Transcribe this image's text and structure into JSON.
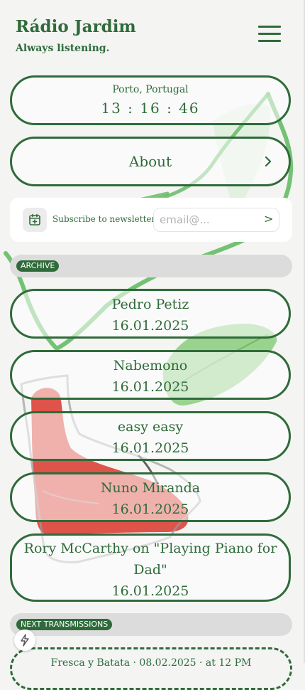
{
  "brand": {
    "title": "Rádio Jardim",
    "subtitle": "Always listening."
  },
  "menu": {
    "icon": "hamburger-menu-icon"
  },
  "clock": {
    "location": "Porto, Portugal",
    "time": "13 : 16 : 46"
  },
  "about": {
    "label": "About",
    "icon": "chevron-right-icon"
  },
  "newsletter": {
    "icon": "calendar-plus-icon",
    "label": "Subscribe to newsletter",
    "placeholder": "email@...",
    "submit": ">"
  },
  "archive": {
    "tag": "ARCHIVE",
    "items": [
      {
        "name": "Pedro Petiz",
        "date": "16.01.2025"
      },
      {
        "name": "Nabemono",
        "date": "16.01.2025"
      },
      {
        "name": "easy easy",
        "date": "16.01.2025"
      },
      {
        "name": "Nuno Miranda",
        "date": "16.01.2025"
      },
      {
        "name": "Rory McCarthy on \"Playing Piano for Dad\"",
        "date": "16.01.2025"
      }
    ]
  },
  "next_transmissions": {
    "tag": "NEXT TRANSMISSIONS",
    "first_item": "Fresca y Batata · 08.02.2025 · at 12 PM"
  },
  "floating": {
    "icon": "lightning-bolt-icon"
  },
  "colors": {
    "accent": "#2f6b3a",
    "background": "#f4f4f3",
    "section_bar": "#dcdcdc"
  }
}
